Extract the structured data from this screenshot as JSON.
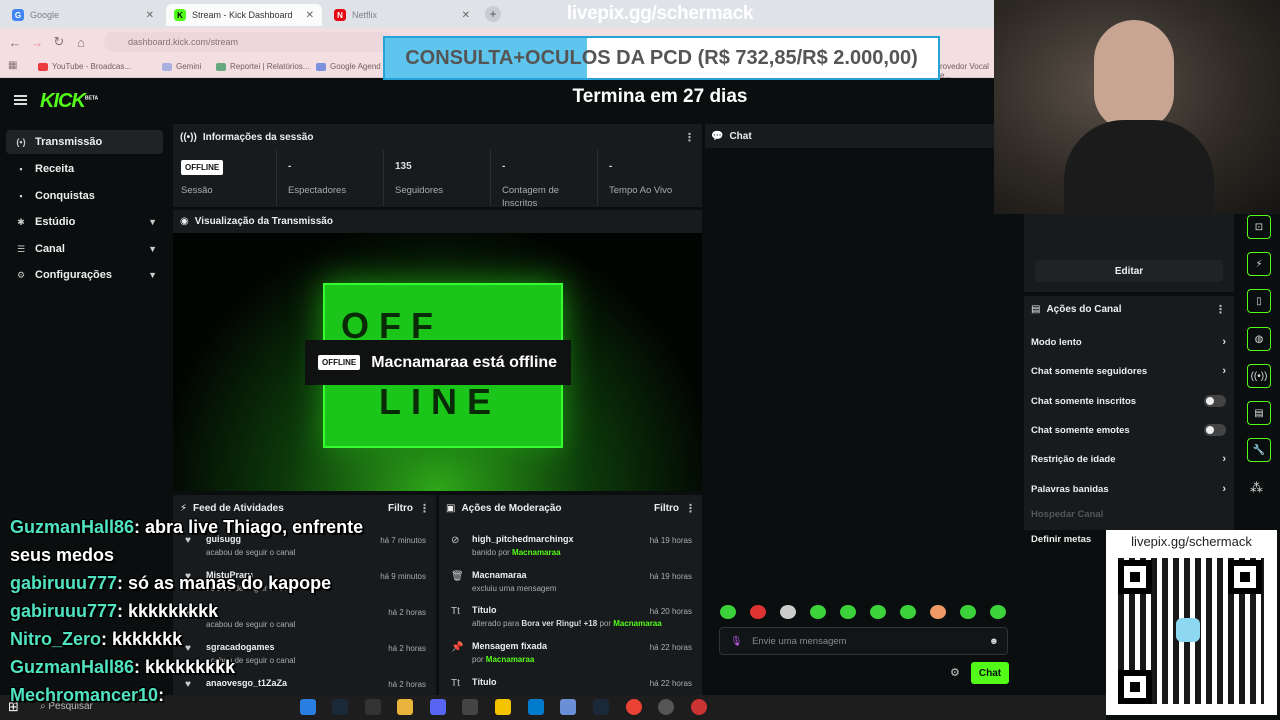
{
  "browser": {
    "tabs": [
      {
        "label": "Google",
        "favicon": "G"
      },
      {
        "label": "Stream - Kick Dashboard",
        "favicon": "K"
      },
      {
        "label": "Netflix",
        "favicon": "N"
      }
    ],
    "url": "dashboard.kick.com/stream",
    "bookmarks": [
      "YouTube - Broadcas...",
      "Gemini",
      "Reportei | Relatórios...",
      "Google Agend",
      "rovedor Vocal e..."
    ]
  },
  "overlay": {
    "livepix_top": "livepix.gg/schermack",
    "goal_text": "CONSULTA+OCULOS DA PCD (R$ 732,85/R$ 2.000,00)",
    "goal_progress": 0.366,
    "termina": "Termina em 27 dias",
    "qr_title": "livepix.gg/schermack"
  },
  "sidebar": {
    "logo": "KICK",
    "logo_sup": "BETA",
    "items": [
      {
        "label": "Transmissão",
        "icon": "(•)",
        "chevron": false
      },
      {
        "label": "Receita",
        "icon": "▪",
        "chevron": false
      },
      {
        "label": "Conquistas",
        "icon": "▪",
        "chevron": false
      },
      {
        "label": "Estúdio",
        "icon": "✱",
        "chevron": true
      },
      {
        "label": "Canal",
        "icon": "☰",
        "chevron": true
      },
      {
        "label": "Configurações",
        "icon": "⚙",
        "chevron": true
      }
    ]
  },
  "session": {
    "title": "Informações da sessão",
    "status_badge": "OFFLINE",
    "stats": [
      {
        "value": "",
        "label": "Sessão"
      },
      {
        "value": "-",
        "label": "Espectadores"
      },
      {
        "value": "135",
        "label": "Seguidores"
      },
      {
        "value": "-",
        "label": "Contagem de Inscritos"
      },
      {
        "value": "-",
        "label": "Tempo Ao Vivo"
      }
    ]
  },
  "preview": {
    "title": "Visualização da Transmissão",
    "sign_top": "OFF",
    "sign_bottom": "LINE",
    "offline_badge": "OFFLINE",
    "offline_text": "Macnamaraa está offline"
  },
  "feed": {
    "title": "Feed de Atividades",
    "filter": "Filtro",
    "rows": [
      {
        "name": "guisugg",
        "sub": "acabou de seguir o canal",
        "time": "há 7 minutos"
      },
      {
        "name": "MistuPraru",
        "sub": "acabou de seguir o canal",
        "time": "há 9 minutos"
      },
      {
        "name": "",
        "sub": "acabou de seguir o canal",
        "time": "há 2 horas"
      },
      {
        "name": "sgracadogames",
        "sub": "acabou de seguir o canal",
        "time": "há 2 horas"
      },
      {
        "name": "anaovesgo_t1ZaZa",
        "sub": "",
        "time": "há 2 horas"
      }
    ]
  },
  "moderation": {
    "title": "Ações de Moderação",
    "filter": "Filtro",
    "rows": [
      {
        "name": "high_pitchedmarchingx",
        "sub": "banido por",
        "by": "Macnamaraa",
        "time": "há 19 horas",
        "icon": "⊘"
      },
      {
        "name": "Macnamaraa",
        "sub": "excluiu uma mensagem",
        "by": "",
        "time": "há 19 horas",
        "icon": "🗑"
      },
      {
        "name": "Título",
        "sub": "alterado para",
        "subbold": "Bora ver Ringu! +18",
        "sub2": "por",
        "by": "Macnamaraa",
        "time": "há 20 horas",
        "icon": "Tt"
      },
      {
        "name": "Mensagem fixada",
        "sub": "por",
        "by": "Macnamaraa",
        "time": "há 22 horas",
        "icon": "📌"
      },
      {
        "name": "Título",
        "sub": "",
        "by": "",
        "time": "há 22 horas",
        "icon": "Tt"
      }
    ]
  },
  "chat": {
    "title": "Chat",
    "placeholder": "Envie uma mensagem",
    "send": "Chat"
  },
  "channel_actions": {
    "edit": "Editar",
    "title": "Ações do Canal",
    "items": [
      {
        "label": "Modo lento",
        "kind": "chevron"
      },
      {
        "label": "Chat somente seguidores",
        "kind": "chevron"
      },
      {
        "label": "Chat somente inscritos",
        "kind": "toggle"
      },
      {
        "label": "Chat somente emotes",
        "kind": "toggle"
      },
      {
        "label": "Restrição de idade",
        "kind": "chevron"
      },
      {
        "label": "Palavras banidas",
        "kind": "chevron"
      },
      {
        "label": "Hospedar Canal",
        "kind": "disabled"
      },
      {
        "label": "Definir metas",
        "kind": "none"
      }
    ]
  },
  "stream_chat": [
    {
      "user": "GuzmanHall86",
      "msg": ": abra live Thiago, enfrente"
    },
    {
      "user": "",
      "msg": "seus medos"
    },
    {
      "user": "gabiruuu777",
      "msg": ": só as manas do kapope"
    },
    {
      "user": "gabiruuu777",
      "msg": ": kkkkkkkkk"
    },
    {
      "user": "Nitro_Zero",
      "msg": ": kkkkkkk"
    },
    {
      "user": "GuzmanHall86",
      "msg": ": kkkkkkkkk"
    },
    {
      "user": "Mechromancer10",
      "msg": ":"
    }
  ],
  "taskbar": {
    "search": "Pesquisar"
  },
  "colors": {
    "accent": "#53fc18",
    "panel": "#181b1d",
    "bg": "#0b0e0f"
  }
}
